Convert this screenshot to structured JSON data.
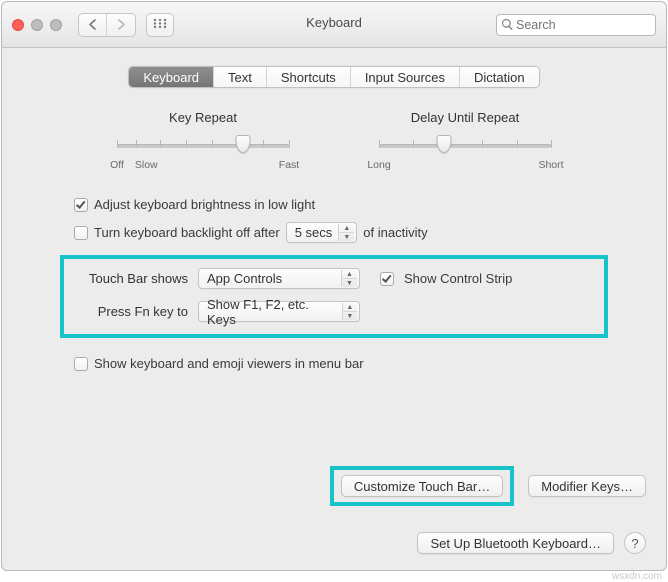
{
  "window": {
    "title": "Keyboard",
    "search_placeholder": "Search"
  },
  "tabs": [
    {
      "label": "Keyboard",
      "active": true
    },
    {
      "label": "Text",
      "active": false
    },
    {
      "label": "Shortcuts",
      "active": false
    },
    {
      "label": "Input Sources",
      "active": false
    },
    {
      "label": "Dictation",
      "active": false
    }
  ],
  "sliders": {
    "key_repeat": {
      "title": "Key Repeat",
      "labels_left": "Off",
      "labels_left2": "Slow",
      "labels_right": "Fast",
      "position_pct": 73
    },
    "delay_repeat": {
      "title": "Delay Until Repeat",
      "labels_left": "Long",
      "labels_right": "Short",
      "position_pct": 38
    }
  },
  "checks": {
    "adjust_brightness": {
      "label": "Adjust keyboard brightness in low light",
      "checked": true
    },
    "backlight_off": {
      "prefix": "Turn keyboard backlight off after",
      "suffix": "of inactivity",
      "checked": false,
      "value": "5 secs"
    },
    "show_control_strip": {
      "label": "Show Control Strip",
      "checked": true
    },
    "show_viewers": {
      "label": "Show keyboard and emoji viewers in menu bar",
      "checked": false
    }
  },
  "touchbar": {
    "shows_label": "Touch Bar shows",
    "shows_value": "App Controls",
    "fn_label": "Press Fn key to",
    "fn_value": "Show F1, F2, etc. Keys"
  },
  "buttons": {
    "customize": "Customize Touch Bar…",
    "modifier": "Modifier Keys…",
    "bluetooth": "Set Up Bluetooth Keyboard…",
    "help": "?"
  },
  "watermark": "wsxdn.com"
}
